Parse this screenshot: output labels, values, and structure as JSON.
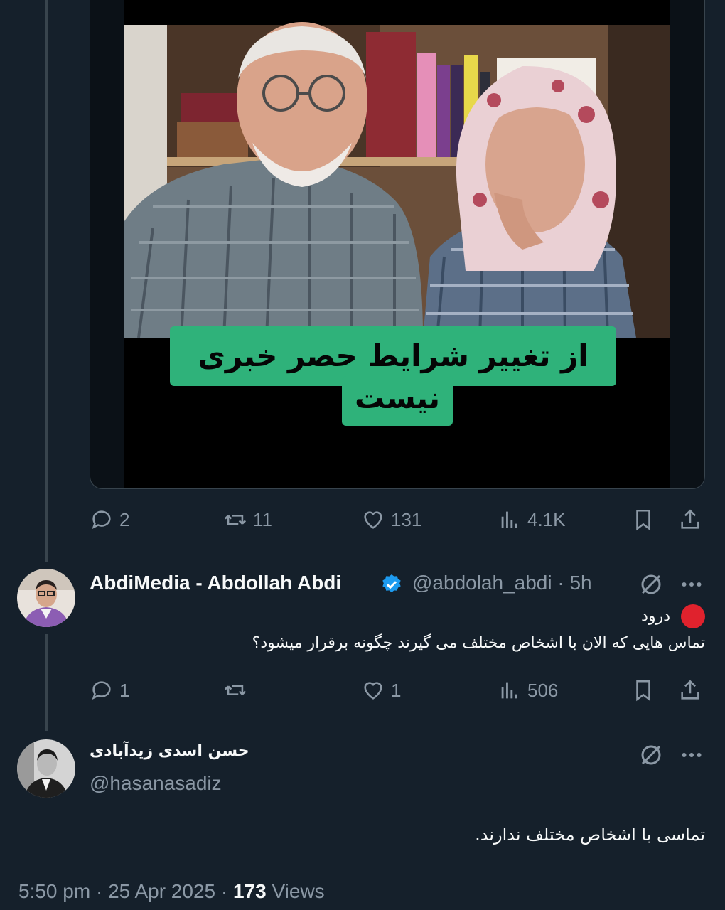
{
  "media": {
    "caption_line1": "از تغییر شرایط حصر خبری",
    "caption_line2": "نیست"
  },
  "post_actions": {
    "replies": "2",
    "reposts": "11",
    "likes": "131",
    "views": "4.1K"
  },
  "reply1": {
    "display_name": "AbdiMedia - Abdollah Abdi",
    "handle": "@abdolah_abdi",
    "separator": "·",
    "time": "5h",
    "line1": "درود",
    "line2": "تماس هایی که الان با اشخاص مختلف می گیرند چگونه برقرار میشود؟",
    "emoji": "red-circle-icon",
    "verified_color": "#1d9bf0",
    "actions": {
      "replies": "1",
      "reposts": "",
      "likes": "1",
      "views": "506"
    }
  },
  "reply2": {
    "display_name": "حسن اسدی زیدآبادی",
    "handle": "@hasanasadiz",
    "text": "تماسی با اشخاص مختلف ندارند."
  },
  "footer": {
    "time": "5:50 pm",
    "sep1": " · ",
    "date": "25 Apr 2025",
    "sep2": " · ",
    "views_count": "173",
    "views_label": " Views"
  },
  "colors": {
    "background": "#15202b",
    "muted": "#8b98a5",
    "caption_green": "#2fb27a"
  }
}
